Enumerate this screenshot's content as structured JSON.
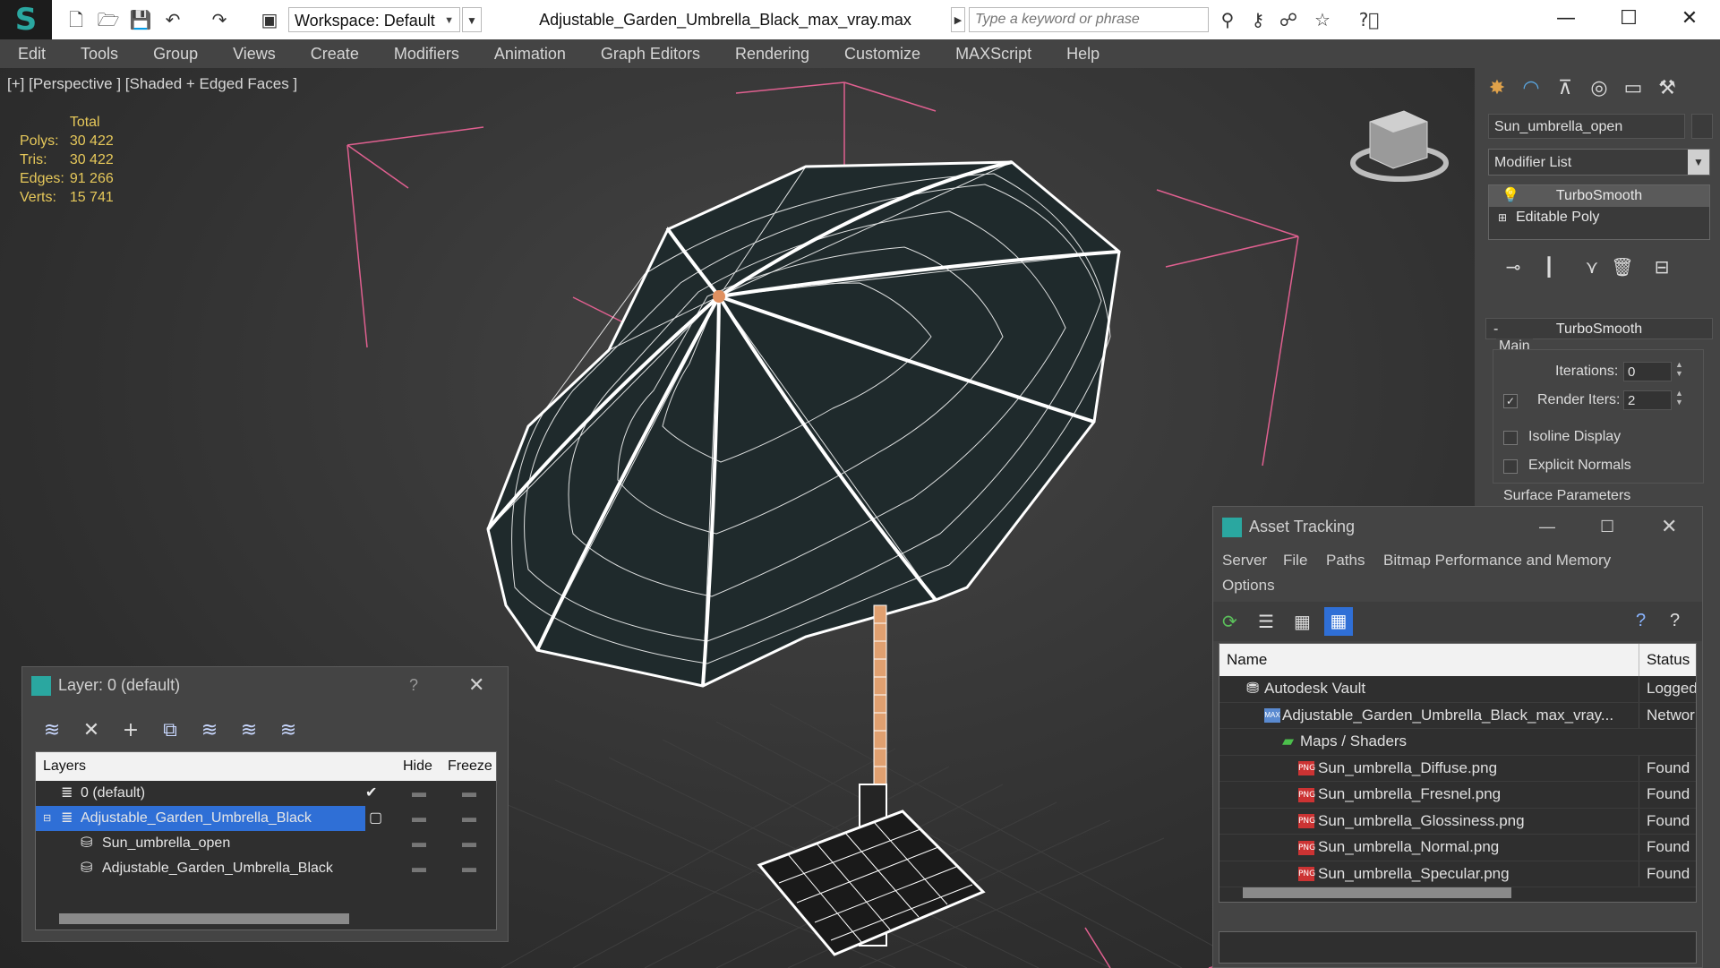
{
  "titlebar": {
    "workspace_label": "Workspace: Default",
    "document_title": "Adjustable_Garden_Umbrella_Black_max_vray.max",
    "search_placeholder": "Type a keyword or phrase"
  },
  "menu": [
    "Edit",
    "Tools",
    "Group",
    "Views",
    "Create",
    "Modifiers",
    "Animation",
    "Graph Editors",
    "Rendering",
    "Customize",
    "MAXScript",
    "Help"
  ],
  "viewport": {
    "label": "[+] [Perspective ] [Shaded + Edged Faces ]",
    "stats": {
      "total_label": "Total",
      "rows": [
        {
          "label": "Polys:",
          "value": "30 422"
        },
        {
          "label": "Tris:",
          "value": "30 422"
        },
        {
          "label": "Edges:",
          "value": "91 266"
        },
        {
          "label": "Verts:",
          "value": "15 741"
        }
      ]
    }
  },
  "command_panel": {
    "object_name": "Sun_umbrella_open",
    "modifier_list": "Modifier List",
    "stack": [
      "TurboSmooth",
      "Editable Poly"
    ],
    "rollout_title": "TurboSmooth",
    "group_main": "Main",
    "iterations_label": "Iterations:",
    "iterations_value": "0",
    "render_iters_label": "Render Iters:",
    "render_iters_value": "2",
    "isoline_label": "Isoline Display",
    "explicit_normals_label": "Explicit Normals",
    "surface_params_label": "Surface Parameters"
  },
  "layer_dialog": {
    "title": "Layer: 0 (default)",
    "help": "?",
    "headers": {
      "layers": "Layers",
      "hide": "Hide",
      "freeze": "Freeze"
    },
    "rows": [
      {
        "name": "0 (default)"
      },
      {
        "name": "Adjustable_Garden_Umbrella_Black"
      },
      {
        "name": "Sun_umbrella_open"
      },
      {
        "name": "Adjustable_Garden_Umbrella_Black"
      }
    ]
  },
  "asset_dialog": {
    "title": "Asset Tracking",
    "menu": [
      "Server",
      "File",
      "Paths",
      "Bitmap Performance and Memory",
      "Options"
    ],
    "headers": {
      "name": "Name",
      "status": "Status"
    },
    "rows": [
      {
        "name": "Autodesk Vault",
        "status": "Logged"
      },
      {
        "name": "Adjustable_Garden_Umbrella_Black_max_vray...",
        "status": "Network"
      },
      {
        "name": "Maps / Shaders",
        "status": ""
      },
      {
        "name": "Sun_umbrella_Diffuse.png",
        "status": "Found"
      },
      {
        "name": "Sun_umbrella_Fresnel.png",
        "status": "Found"
      },
      {
        "name": "Sun_umbrella_Glossiness.png",
        "status": "Found"
      },
      {
        "name": "Sun_umbrella_Normal.png",
        "status": "Found"
      },
      {
        "name": "Sun_umbrella_Specular.png",
        "status": "Found"
      }
    ],
    "png_tag": "PNG",
    "max_tag": "MAX"
  },
  "colors": {
    "accent": "#2aa7a0",
    "selection": "#2f6fd6",
    "stats": "#e6c85a",
    "gizmo": "#e06090"
  }
}
